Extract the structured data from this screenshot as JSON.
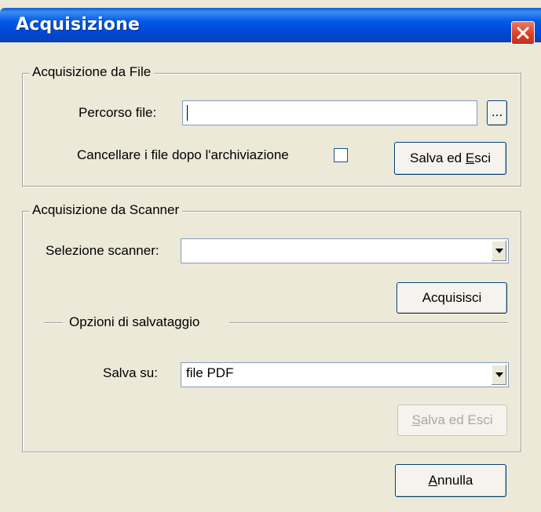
{
  "window": {
    "title": "Acquisizione"
  },
  "file_group": {
    "legend": "Acquisizione da File",
    "path_label": "Percorso file:",
    "path_value": "",
    "browse_label": "...",
    "delete_label": "Cancellare i file dopo l'archiviazione",
    "delete_checked": false,
    "save_exit_pre": "Salva ed ",
    "save_exit_mnemonic": "E",
    "save_exit_post": "sci"
  },
  "scanner_group": {
    "legend": "Acquisizione da Scanner",
    "scanner_label": "Selezione scanner:",
    "scanner_value": "",
    "acquire_label": "Acquisisci",
    "options_legend": "Opzioni di salvataggio",
    "save_on_label": "Salva su:",
    "save_on_value": "file PDF",
    "save_exit_mnemonic": "S",
    "save_exit_post": "alva ed Esci"
  },
  "footer": {
    "cancel_mnemonic": "A",
    "cancel_post": "nnulla"
  },
  "icons": {
    "close": "close-icon",
    "dropdown": "chevron-down-icon"
  },
  "colors": {
    "titlebar": "#0058E6",
    "close": "#D9402A",
    "dialog_bg": "#ECE9D8"
  }
}
